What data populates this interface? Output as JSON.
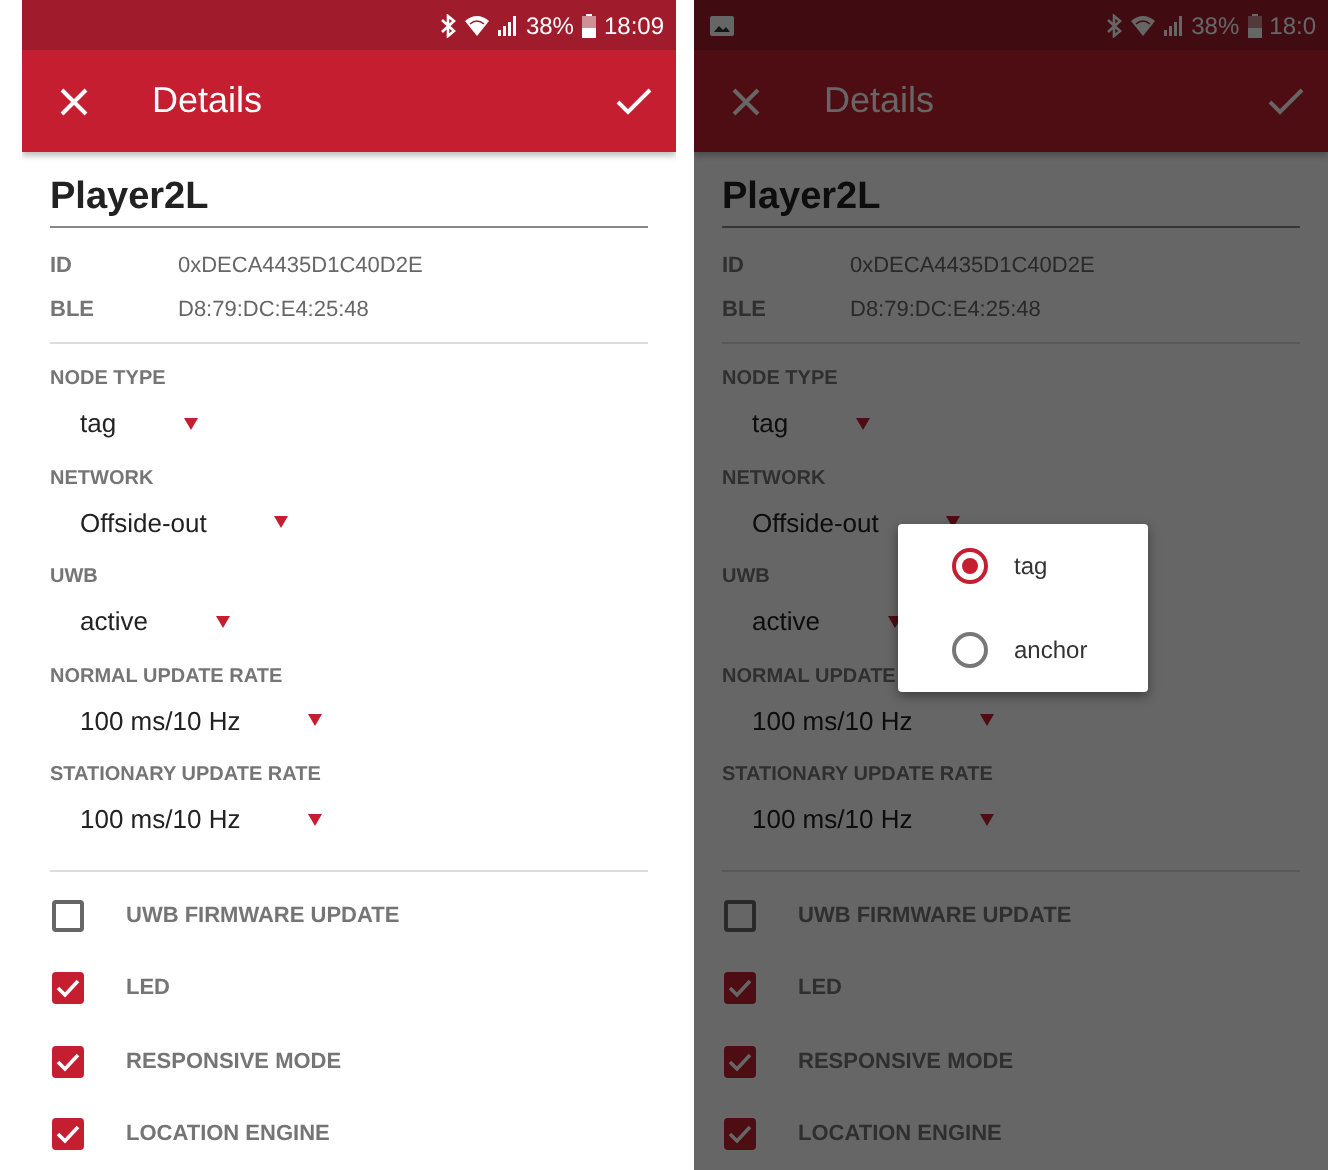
{
  "screens": [
    {
      "dimmed": false,
      "status_bar": {
        "notification": false,
        "battery": "38%",
        "time": "18:09"
      },
      "app_bar": {
        "title": "Details"
      },
      "name": "Player2L",
      "info": [
        {
          "label": "ID",
          "value": "0xDECA4435D1C40D2E"
        },
        {
          "label": "BLE",
          "value": "D8:79:DC:E4:25:48"
        }
      ],
      "dropdowns": [
        {
          "label": "NODE TYPE",
          "value": "tag"
        },
        {
          "label": "NETWORK",
          "value": "Offside-out"
        },
        {
          "label": "UWB",
          "value": "active"
        },
        {
          "label": "NORMAL UPDATE RATE",
          "value": "100 ms/10 Hz"
        },
        {
          "label": "STATIONARY UPDATE RATE",
          "value": "100 ms/10 Hz"
        }
      ],
      "checkboxes": [
        {
          "label": "UWB FIRMWARE UPDATE",
          "checked": false
        },
        {
          "label": "LED",
          "checked": true
        },
        {
          "label": "RESPONSIVE MODE",
          "checked": true
        },
        {
          "label": "LOCATION ENGINE",
          "checked": true
        }
      ]
    },
    {
      "dimmed": true,
      "status_bar": {
        "notification": true,
        "battery": "38%",
        "time": "18:0"
      },
      "app_bar": {
        "title": "Details"
      },
      "name": "Player2L",
      "info": [
        {
          "label": "ID",
          "value": "0xDECA4435D1C40D2E"
        },
        {
          "label": "BLE",
          "value": "D8:79:DC:E4:25:48"
        }
      ],
      "dropdowns": [
        {
          "label": "NODE TYPE",
          "value": "tag"
        },
        {
          "label": "NETWORK",
          "value": "Offside-out"
        },
        {
          "label": "UWB",
          "value": "active"
        },
        {
          "label": "NORMAL UPDATE",
          "value": "100 ms/10 Hz"
        },
        {
          "label": "STATIONARY UPDATE RATE",
          "value": "100 ms/10 Hz"
        }
      ],
      "checkboxes": [
        {
          "label": "UWB FIRMWARE UPDATE",
          "checked": false
        },
        {
          "label": "LED",
          "checked": true
        },
        {
          "label": "RESPONSIVE MODE",
          "checked": true
        },
        {
          "label": "LOCATION ENGINE",
          "checked": true
        }
      ],
      "dialog": {
        "options": [
          {
            "label": "tag",
            "selected": true
          },
          {
            "label": "anchor",
            "selected": false
          }
        ]
      }
    }
  ]
}
